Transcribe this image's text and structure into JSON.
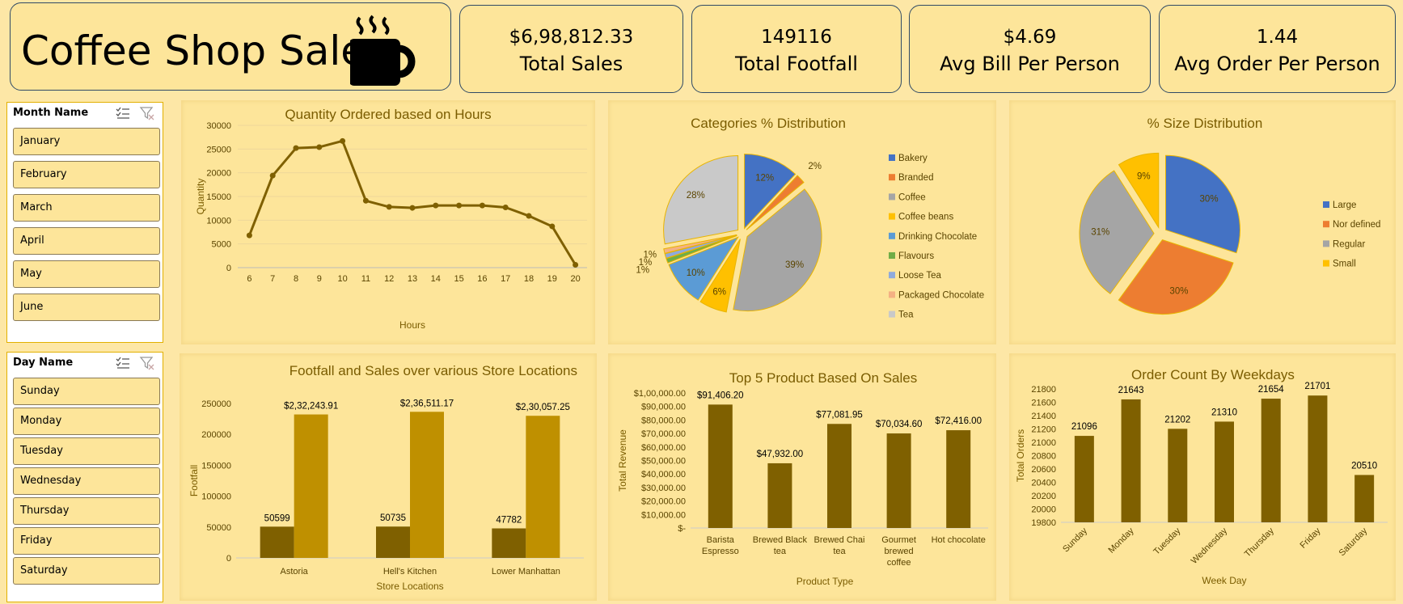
{
  "title": "Coffee Shop Sales",
  "kpis": [
    {
      "value": "$6,98,812.33",
      "label": "Total Sales"
    },
    {
      "value": "149116",
      "label": "Total Footfall"
    },
    {
      "value": "$4.69",
      "label": "Avg Bill Per Person"
    },
    {
      "value": "1.44",
      "label": "Avg Order Per Person"
    }
  ],
  "slicers": {
    "month": {
      "title": "Month Name",
      "items": [
        "January",
        "February",
        "March",
        "April",
        "May",
        "June"
      ]
    },
    "day": {
      "title": "Day Name",
      "items": [
        "Sunday",
        "Monday",
        "Tuesday",
        "Wednesday",
        "Thursday",
        "Friday",
        "Saturday"
      ]
    }
  },
  "colors": {
    "background": "#fde7a6",
    "panel": "#fde59a",
    "dark_gold": "#7f6000",
    "gold": "#bf9000",
    "title_text": "#7a5c00"
  },
  "icons": [
    "coffee-mug-icon",
    "multi-select-icon",
    "clear-filter-icon"
  ],
  "chart_data": [
    {
      "id": "hours",
      "type": "line",
      "title": "Quantity Ordered based on Hours",
      "xlabel": "Hours",
      "ylabel": "Quantity",
      "x": [
        6,
        7,
        8,
        9,
        10,
        11,
        12,
        13,
        14,
        15,
        16,
        17,
        18,
        19,
        20
      ],
      "values": [
        6800,
        19400,
        25200,
        25400,
        26700,
        14100,
        12800,
        12600,
        13100,
        13100,
        13100,
        12700,
        10900,
        8700,
        600
      ],
      "ylim": [
        0,
        30000
      ],
      "yticks": [
        "0",
        "5000",
        "10000",
        "15000",
        "20000",
        "25000",
        "30000"
      ],
      "grid": true
    },
    {
      "id": "categories",
      "type": "pie",
      "title": "Categories % Distribution",
      "labels": [
        "Bakery",
        "Branded",
        "Coffee",
        "Coffee beans",
        "Drinking Chocolate",
        "Flavours",
        "Loose Tea",
        "Packaged Chocolate",
        "Tea"
      ],
      "values": [
        12,
        2,
        39,
        6,
        10,
        1,
        1,
        1,
        28
      ],
      "data_labels": [
        "12%",
        "2%",
        "39%",
        "6%",
        "10%",
        "1%",
        "1%",
        "1%",
        "28%"
      ],
      "colors": [
        "#4472c4",
        "#ed7d31",
        "#a5a5a5",
        "#ffc000",
        "#5b9bd5",
        "#70ad47",
        "#8faadc",
        "#f4b183",
        "#c9c9c9"
      ],
      "legend": "right"
    },
    {
      "id": "size",
      "type": "pie",
      "title": "%  Size Distribution",
      "labels": [
        "Large",
        "Nor defined",
        "Regular",
        "Small"
      ],
      "values": [
        30,
        30,
        31,
        9
      ],
      "data_labels": [
        "30%",
        "30%",
        "31%",
        "9%"
      ],
      "colors": [
        "#4472c4",
        "#ed7d31",
        "#a5a5a5",
        "#ffc000"
      ],
      "legend": "right"
    },
    {
      "id": "stores",
      "type": "bar",
      "title": "Footfall and Sales over various Store Locations",
      "xlabel": "Store Locations",
      "ylabel": "Footfall",
      "categories": [
        "Astoria",
        "Hell's Kitchen",
        "Lower Manhattan"
      ],
      "series": [
        {
          "values": [
            50599,
            50735,
            47782
          ],
          "labels": [
            "50599",
            "50735",
            "47782"
          ],
          "color": "#7f6000"
        },
        {
          "values": [
            232243.91,
            236511.17,
            230057.25
          ],
          "labels": [
            "$2,32,243.91",
            "$2,36,511.17",
            "$2,30,057.25"
          ],
          "color": "#bf9000"
        }
      ],
      "ylim": [
        0,
        250000
      ],
      "yticks": [
        "0",
        "50000",
        "100000",
        "150000",
        "200000",
        "250000"
      ]
    },
    {
      "id": "top5",
      "type": "bar",
      "title": "Top 5 Product Based On Sales",
      "xlabel": "Product Type",
      "ylabel": "Total Revenue",
      "categories": [
        [
          "Barista",
          "Espresso"
        ],
        [
          "Brewed Black",
          "tea"
        ],
        [
          "Brewed Chai",
          "tea"
        ],
        [
          "Gourmet",
          "brewed",
          "coffee"
        ],
        [
          "Hot chocolate"
        ]
      ],
      "values": [
        91406.2,
        47932.0,
        77081.95,
        70034.6,
        72416.0
      ],
      "labels": [
        "$91,406.20",
        "$47,932.00",
        "$77,081.95",
        "$70,034.60",
        "$72,416.00"
      ],
      "ylim": [
        0,
        100000
      ],
      "yticks": [
        "$-",
        "$10,000.00",
        "$20,000.00",
        "$30,000.00",
        "$40,000.00",
        "$50,000.00",
        "$60,000.00",
        "$70,000.00",
        "$80,000.00",
        "$90,000.00",
        "$1,00,000.00"
      ]
    },
    {
      "id": "weekdays",
      "type": "bar",
      "title": "Order Count By Weekdays",
      "xlabel": "Week Day",
      "ylabel": "Total Orders",
      "categories": [
        "Sunday",
        "Monday",
        "Tuesday",
        "Wednesday",
        "Thursday",
        "Friday",
        "Saturday"
      ],
      "values": [
        21096,
        21643,
        21202,
        21310,
        21654,
        21701,
        20510
      ],
      "labels": [
        "21096",
        "21643",
        "21202",
        "21310",
        "21654",
        "21701",
        "20510"
      ],
      "ylim": [
        19800,
        21800
      ],
      "yticks": [
        "19800",
        "20000",
        "20200",
        "20400",
        "20600",
        "20800",
        "21000",
        "21200",
        "21400",
        "21600",
        "21800"
      ]
    }
  ]
}
